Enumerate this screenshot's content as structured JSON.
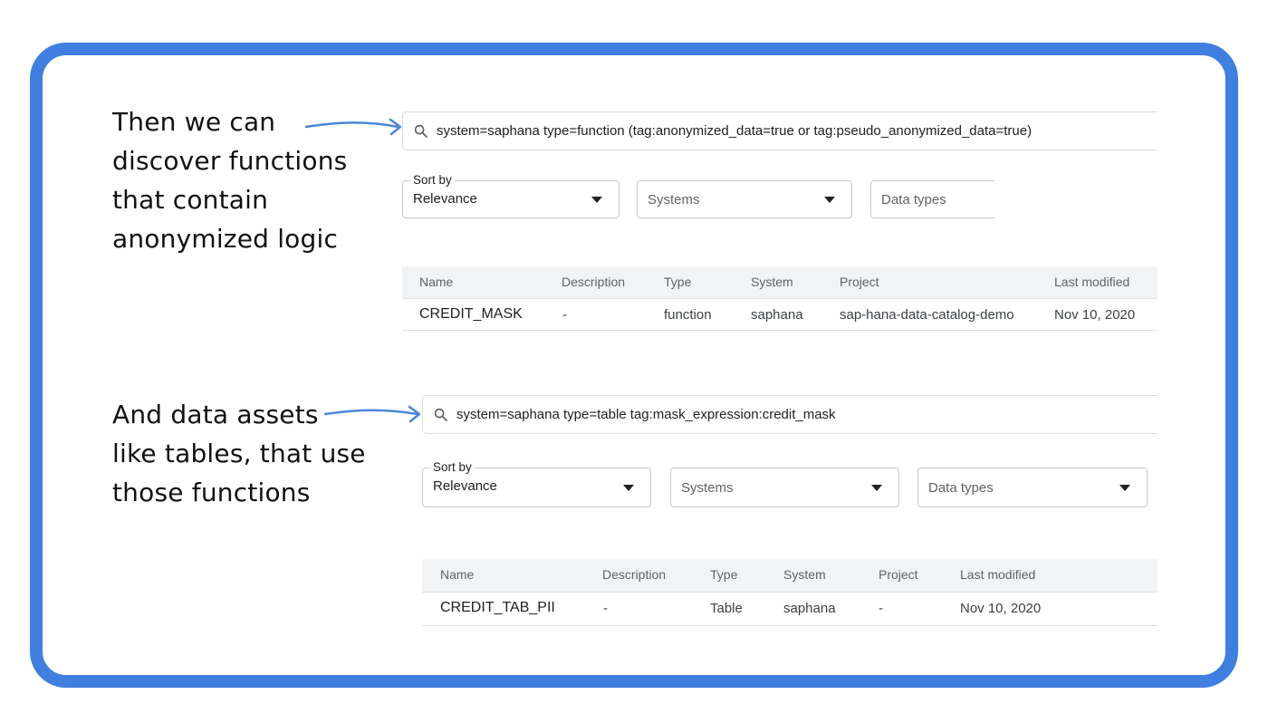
{
  "colors": {
    "frame": "#3f7fe0",
    "arrow": "#4a86d8"
  },
  "section1": {
    "callout": [
      "Then we can",
      "discover functions",
      "that contain",
      "anonymized logic"
    ],
    "search": {
      "icon": "search-icon",
      "query": "system=saphana type=function (tag:anonymized_data=true or tag:pseudo_anonymized_data=true)"
    },
    "filters": {
      "sort_label": "Sort by",
      "sort_value": "Relevance",
      "systems": "Systems",
      "data_types": "Data types"
    },
    "table": {
      "columns": [
        "Name",
        "Description",
        "Type",
        "System",
        "Project",
        "Last modified"
      ],
      "rows": [
        [
          "CREDIT_MASK",
          "-",
          "function",
          "saphana",
          "sap-hana-data-catalog-demo",
          "Nov 10, 2020"
        ]
      ]
    }
  },
  "section2": {
    "callout": [
      "And data assets",
      "like tables, that use",
      "those functions"
    ],
    "search": {
      "icon": "search-icon",
      "query": "system=saphana type=table tag:mask_expression:credit_mask"
    },
    "filters": {
      "sort_label": "Sort by",
      "sort_value": "Relevance",
      "systems": "Systems",
      "data_types": "Data types"
    },
    "table": {
      "columns": [
        "Name",
        "Description",
        "Type",
        "System",
        "Project",
        "Last modified"
      ],
      "rows": [
        [
          "CREDIT_TAB_PII",
          "-",
          "Table",
          "saphana",
          "-",
          "Nov 10, 2020"
        ]
      ]
    }
  }
}
